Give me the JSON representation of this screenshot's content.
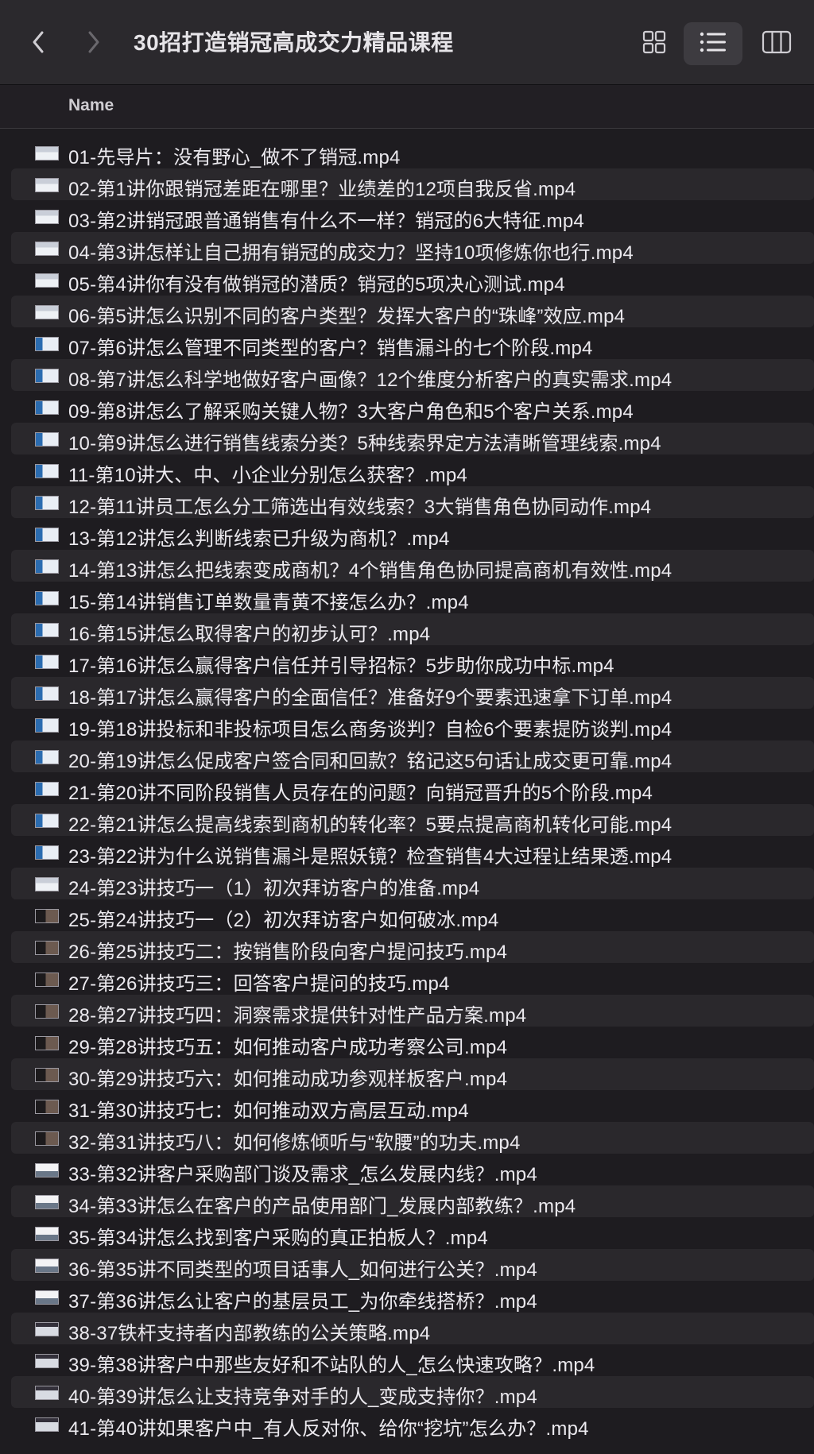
{
  "window": {
    "title": "30招打造销冠高成交力精品课程"
  },
  "toolbar": {
    "back_icon": "chevron-left-icon",
    "forward_icon": "chevron-right-icon",
    "views": [
      {
        "icon": "grid-view-icon",
        "active": false
      },
      {
        "icon": "list-view-icon",
        "active": true
      },
      {
        "icon": "column-view-icon",
        "active": false
      }
    ]
  },
  "list_header": {
    "name": "Name"
  },
  "files": [
    {
      "name": "01-先导片：没有野心_做不了销冠.mp4"
    },
    {
      "name": "02-第1讲你跟销冠差距在哪里？业绩差的12项自我反省.mp4"
    },
    {
      "name": "03-第2讲销冠跟普通销售有什么不一样？销冠的6大特征.mp4"
    },
    {
      "name": "04-第3讲怎样让自己拥有销冠的成交力？坚持10项修炼你也行.mp4"
    },
    {
      "name": "05-第4讲你有没有做销冠的潜质？销冠的5项决心测试.mp4"
    },
    {
      "name": "06-第5讲怎么识别不同的客户类型？发挥大客户的“珠峰”效应.mp4"
    },
    {
      "name": "07-第6讲怎么管理不同类型的客户？销售漏斗的七个阶段.mp4"
    },
    {
      "name": "08-第7讲怎么科学地做好客户画像？12个维度分析客户的真实需求.mp4"
    },
    {
      "name": "09-第8讲怎么了解采购关键人物？3大客户角色和5个客户关系.mp4"
    },
    {
      "name": "10-第9讲怎么进行销售线索分类？5种线索界定方法清晰管理线索.mp4"
    },
    {
      "name": "11-第10讲大、中、小企业分别怎么获客？.mp4"
    },
    {
      "name": "12-第11讲员工怎么分工筛选出有效线索？3大销售角色协同动作.mp4"
    },
    {
      "name": "13-第12讲怎么判断线索已升级为商机？.mp4"
    },
    {
      "name": "14-第13讲怎么把线索变成商机？4个销售角色协同提高商机有效性.mp4"
    },
    {
      "name": "15-第14讲销售订单数量青黄不接怎么办？.mp4"
    },
    {
      "name": "16-第15讲怎么取得客户的初步认可？.mp4"
    },
    {
      "name": "17-第16讲怎么赢得客户信任并引导招标？5步助你成功中标.mp4"
    },
    {
      "name": "18-第17讲怎么赢得客户的全面信任？准备好9个要素迅速拿下订单.mp4"
    },
    {
      "name": "19-第18讲投标和非投标项目怎么商务谈判？自检6个要素提防谈判.mp4"
    },
    {
      "name": "20-第19讲怎么促成客户签合同和回款？铭记这5句话让成交更可靠.mp4"
    },
    {
      "name": "21-第20讲不同阶段销售人员存在的问题？向销冠晋升的5个阶段.mp4"
    },
    {
      "name": "22-第21讲怎么提高线索到商机的转化率？5要点提高商机转化可能.mp4"
    },
    {
      "name": "23-第22讲为什么说销售漏斗是照妖镜？检查销售4大过程让结果透.mp4"
    },
    {
      "name": "24-第23讲技巧一（1）初次拜访客户的准备.mp4"
    },
    {
      "name": "25-第24讲技巧一（2）初次拜访客户如何破冰.mp4"
    },
    {
      "name": "26-第25讲技巧二：按销售阶段向客户提问技巧.mp4"
    },
    {
      "name": "27-第26讲技巧三：回答客户提问的技巧.mp4"
    },
    {
      "name": "28-第27讲技巧四：洞察需求提供针对性产品方案.mp4"
    },
    {
      "name": "29-第28讲技巧五：如何推动客户成功考察公司.mp4"
    },
    {
      "name": "30-第29讲技巧六：如何推动成功参观样板客户.mp4"
    },
    {
      "name": "31-第30讲技巧七：如何推动双方高层互动.mp4"
    },
    {
      "name": "32-第31讲技巧八：如何修炼倾听与“软腰”的功夫.mp4"
    },
    {
      "name": "33-第32讲客户采购部门谈及需求_怎么发展内线？.mp4"
    },
    {
      "name": "34-第33讲怎么在客户的产品使用部门_发展内部教练？.mp4"
    },
    {
      "name": "35-第34讲怎么找到客户采购的真正拍板人？.mp4"
    },
    {
      "name": "36-第35讲不同类型的项目话事人_如何进行公关？.mp4"
    },
    {
      "name": "37-第36讲怎么让客户的基层员工_为你牵线搭桥？.mp4"
    },
    {
      "name": "38-37铁杆支持者内部教练的公关策略.mp4"
    },
    {
      "name": "39-第38讲客户中那些友好和不站队的人_怎么快速攻略？.mp4"
    },
    {
      "name": "40-第39讲怎么让支持竞争对手的人_变成支持你？.mp4"
    },
    {
      "name": "41-第40讲如果客户中_有人反对你、给你“挖坑”怎么办？.mp4"
    }
  ]
}
